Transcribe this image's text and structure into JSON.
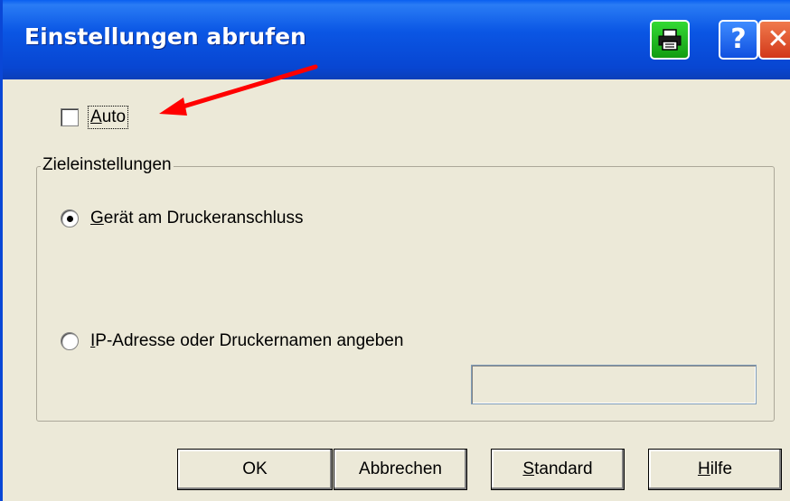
{
  "window": {
    "title": "Einstellungen abrufen",
    "title_buttons": {
      "printer_icon": "printer-icon",
      "help_label": "?",
      "close_label": "✕"
    }
  },
  "auto_checkbox": {
    "label_mnemonic": "A",
    "label_rest": "uto",
    "checked": false
  },
  "target_settings": {
    "title": "Zieleinstellungen",
    "options": [
      {
        "mnemonic": "G",
        "rest": "erät am Druckeranschluss",
        "selected": true
      },
      {
        "mnemonic": "I",
        "rest": "P-Adresse oder Druckernamen angeben",
        "selected": false
      }
    ],
    "ip_value": ""
  },
  "buttons": {
    "ok": "OK",
    "cancel": "Abbrechen",
    "standard_mnemonic": "S",
    "standard_rest": "tandard",
    "help_mnemonic": "H",
    "help_rest": "ilfe"
  },
  "annotation": {
    "arrow_color": "#ff0000"
  },
  "colors": {
    "titlebar": "#0a56e4",
    "dialog_bg": "#ece9d8",
    "printer_button": "#22b522",
    "close_button": "#e0502a"
  }
}
